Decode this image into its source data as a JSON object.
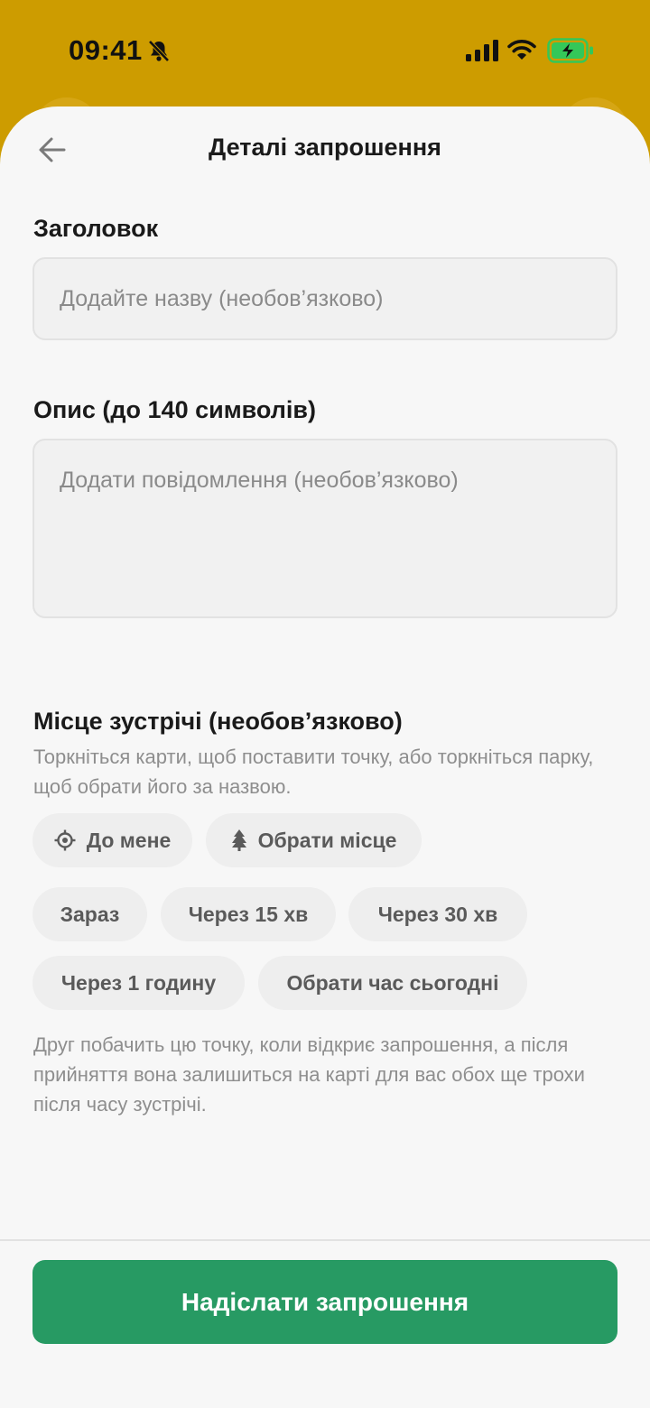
{
  "status_bar": {
    "time": "09:41",
    "icons": [
      "bell-slash-icon",
      "signal-icon",
      "wifi-icon",
      "battery-charging-icon"
    ]
  },
  "header": {
    "title": "Деталі запрошення",
    "back_icon": "arrow-left-icon"
  },
  "form": {
    "title_label": "Заголовок",
    "title_placeholder": "Додайте назву (необов’язково)",
    "title_value": "",
    "description_label": "Опис (до 140 символів)",
    "description_placeholder": "Додати повідомлення (необов’язково)",
    "description_value": ""
  },
  "meeting": {
    "label": "Місце зустрічі (необов’язково)",
    "hint": "Торкніться карти, щоб поставити точку, або торкніться парку, щоб обрати його за назвою.",
    "location_chips": [
      {
        "label": "До мене",
        "icon": "crosshair-icon"
      },
      {
        "label": "Обрати місце",
        "icon": "tree-icon"
      }
    ],
    "time_chips": [
      "Зараз",
      "Через 15 хв",
      "Через 30 хв",
      "Через 1 годину",
      "Обрати час сьогодні"
    ],
    "footnote": "Друг побачить цю точку, коли відкриє запрошення, а після прийняття вона залишиться на карті для вас обох ще трохи після часу зустрічі."
  },
  "actions": {
    "send_label": "Надіслати запрошення"
  },
  "colors": {
    "top_band": "#cd9c00",
    "primary": "#279a63",
    "sheet_background": "#f7f7f7",
    "battery": "#34c759"
  }
}
